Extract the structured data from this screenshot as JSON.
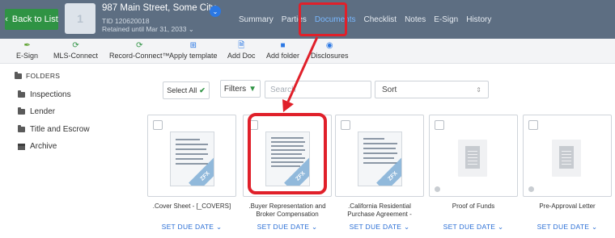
{
  "header": {
    "back_label": "Back to List",
    "logo_text": "1",
    "address": "987 Main Street, Some City",
    "tid": "TID 120620018",
    "retained": "Retained until Mar 31, 2033 ⌄",
    "nav": [
      "Summary",
      "Parties",
      "Documents",
      "Checklist",
      "Notes",
      "E-Sign",
      "History"
    ],
    "active_tab": "Documents"
  },
  "toolbar": {
    "items": [
      "E-Sign",
      "MLS-Connect",
      "Record-Connect™",
      "Apply template",
      "Add Doc",
      "Add folder",
      "Disclosures"
    ]
  },
  "sidebar": {
    "heading": "FOLDERS",
    "folders": [
      "Inspections",
      "Lender",
      "Title and Escrow",
      "Archive"
    ]
  },
  "controls": {
    "select_all": "Select All",
    "filters": "Filters",
    "search_placeholder": "Search",
    "sort_label": "Sort"
  },
  "documents": [
    {
      "title": ".Cover Sheet - [_COVERS]",
      "due": "SET DUE DATE",
      "thumb_badge": "ZFX"
    },
    {
      "title": ".Buyer Representation and",
      "title2": "Broker Compensation",
      "due": "SET DUE DATE",
      "thumb_badge": "ZFX"
    },
    {
      "title": ".California Residential",
      "title2": "Purchase Agreement -",
      "due": "SET DUE DATE",
      "thumb_badge": "ZFX"
    },
    {
      "title": "Proof of Funds",
      "due": "SET DUE DATE"
    },
    {
      "title": "Pre-Approval Letter",
      "due": "SET DUE DATE"
    }
  ],
  "colors": {
    "accent_green": "#2f9344",
    "header": "#5d6e82",
    "highlight_red": "#e0202a",
    "link_blue": "#2b6fd6"
  }
}
